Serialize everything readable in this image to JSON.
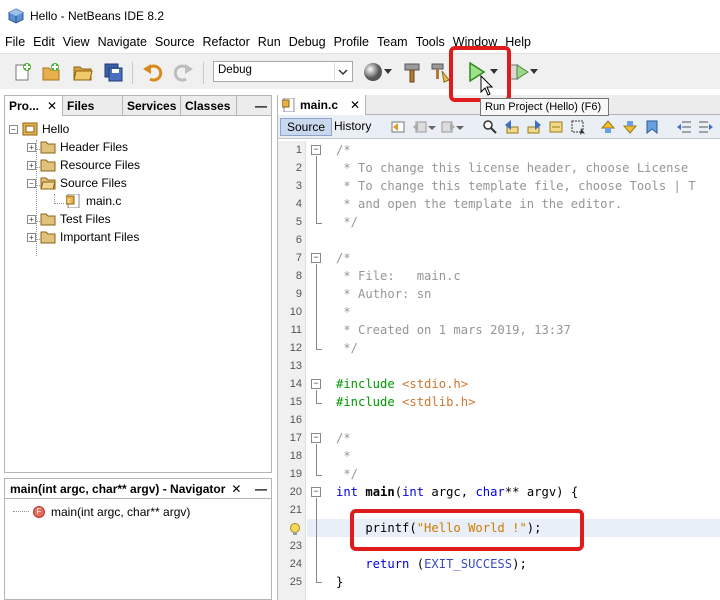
{
  "window": {
    "title": "Hello - NetBeans IDE 8.2"
  },
  "menu": [
    "File",
    "Edit",
    "View",
    "Navigate",
    "Source",
    "Refactor",
    "Run",
    "Debug",
    "Profile",
    "Team",
    "Tools",
    "Window",
    "Help"
  ],
  "toolbar": {
    "config_value": "Debug",
    "tooltip": "Run Project (Hello) (F6)"
  },
  "projects_panel": {
    "tabs": [
      "Pro...",
      "Files",
      "Services",
      "Classes"
    ],
    "close_glyph": "✕",
    "minimize_glyph": "—",
    "tree": {
      "root": "Hello",
      "items": [
        "Header Files",
        "Resource Files",
        "Source Files",
        "main.c",
        "Test Files",
        "Important Files"
      ]
    }
  },
  "navigator": {
    "title": "main(int argc, char** argv) - Navigator",
    "close_glyph": "✕",
    "minimize_glyph": "—",
    "item": "main(int argc, char** argv)"
  },
  "editor": {
    "tab_label": "main.c",
    "close_glyph": "✕",
    "source_label": "Source",
    "history_label": "History",
    "lines": [
      {
        "n": "1",
        "parts": [
          {
            "t": "/*",
            "c": "c-comment"
          }
        ]
      },
      {
        "n": "2",
        "parts": [
          {
            "t": " * To change this license header, choose License",
            "c": "c-comment"
          }
        ]
      },
      {
        "n": "3",
        "parts": [
          {
            "t": " * To change this template file, choose Tools | T",
            "c": "c-comment"
          }
        ]
      },
      {
        "n": "4",
        "parts": [
          {
            "t": " * and open the template in the editor.",
            "c": "c-comment"
          }
        ]
      },
      {
        "n": "5",
        "parts": [
          {
            "t": " */",
            "c": "c-comment"
          }
        ]
      },
      {
        "n": "6",
        "parts": []
      },
      {
        "n": "7",
        "parts": [
          {
            "t": "/*",
            "c": "c-comment"
          }
        ]
      },
      {
        "n": "8",
        "parts": [
          {
            "t": " * File:   main.c",
            "c": "c-comment"
          }
        ]
      },
      {
        "n": "9",
        "parts": [
          {
            "t": " * Author: sn",
            "c": "c-comment"
          }
        ]
      },
      {
        "n": "10",
        "parts": [
          {
            "t": " *",
            "c": "c-comment"
          }
        ]
      },
      {
        "n": "11",
        "parts": [
          {
            "t": " * Created on 1 mars 2019, 13:37",
            "c": "c-comment"
          }
        ]
      },
      {
        "n": "12",
        "parts": [
          {
            "t": " */",
            "c": "c-comment"
          }
        ]
      },
      {
        "n": "13",
        "parts": []
      },
      {
        "n": "14",
        "parts": [
          {
            "t": "#include ",
            "c": "c-pre"
          },
          {
            "t": "<stdio.h>",
            "c": "c-inc"
          }
        ]
      },
      {
        "n": "15",
        "parts": [
          {
            "t": "#include ",
            "c": "c-pre"
          },
          {
            "t": "<stdlib.h>",
            "c": "c-inc"
          }
        ]
      },
      {
        "n": "16",
        "parts": []
      },
      {
        "n": "17",
        "parts": [
          {
            "t": "/*",
            "c": "c-comment"
          }
        ]
      },
      {
        "n": "18",
        "parts": [
          {
            "t": " *",
            "c": "c-comment"
          }
        ]
      },
      {
        "n": "19",
        "parts": [
          {
            "t": " */",
            "c": "c-comment"
          }
        ]
      },
      {
        "n": "20",
        "parts": [
          {
            "t": "int ",
            "c": "c-kw"
          },
          {
            "t": "main",
            "c": "c-fn"
          },
          {
            "t": "(",
            "c": "c-plain"
          },
          {
            "t": "int ",
            "c": "c-kw"
          },
          {
            "t": "argc, ",
            "c": "c-plain"
          },
          {
            "t": "char",
            "c": "c-kw"
          },
          {
            "t": "** argv) {",
            "c": "c-plain"
          }
        ]
      },
      {
        "n": "21",
        "parts": []
      },
      {
        "n": "",
        "parts": [
          {
            "t": "    printf(",
            "c": "c-plain"
          },
          {
            "t": "\"Hello World !\"",
            "c": "c-str"
          },
          {
            "t": ");",
            "c": "c-plain"
          }
        ]
      },
      {
        "n": "23",
        "parts": []
      },
      {
        "n": "24",
        "parts": [
          {
            "t": "    return ",
            "c": "c-kw"
          },
          {
            "t": "(",
            "c": "c-plain"
          },
          {
            "t": "EXIT_SUCCESS",
            "c": "c-macro"
          },
          {
            "t": ");",
            "c": "c-plain"
          }
        ]
      },
      {
        "n": "25",
        "parts": [
          {
            "t": "}",
            "c": "c-plain"
          }
        ]
      }
    ]
  },
  "colors": {
    "highlight": "#e01b1b",
    "run_green": "#3aa83a"
  }
}
